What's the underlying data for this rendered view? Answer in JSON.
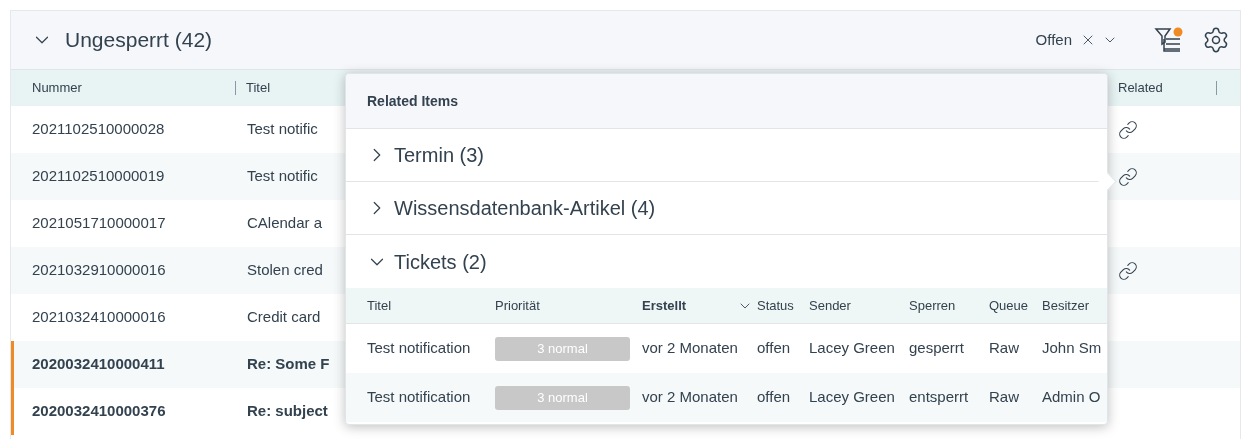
{
  "panel": {
    "title": "Ungesperrt (42)",
    "expanded": true,
    "filter": {
      "value": "Offen"
    }
  },
  "table": {
    "columns": [
      "Nummer",
      "Titel",
      "Related"
    ],
    "rows": [
      {
        "number": "2021102510000028",
        "title": "Test notific",
        "related": true,
        "unread": false
      },
      {
        "number": "2021102510000019",
        "title": "Test notific",
        "related": true,
        "unread": false
      },
      {
        "number": "2021051710000017",
        "title": "CAlendar a",
        "related": false,
        "unread": false
      },
      {
        "number": "2021032910000016",
        "title": "Stolen cred",
        "related": true,
        "unread": false
      },
      {
        "number": "2021032410000016",
        "title": "Credit card",
        "related": false,
        "unread": false
      },
      {
        "number": "2020032410000411",
        "title": "Re: Some F",
        "related": false,
        "unread": true
      },
      {
        "number": "2020032410000376",
        "title": "Re: subject",
        "related": false,
        "unread": true
      }
    ]
  },
  "popover": {
    "title": "Related Items",
    "sections": [
      {
        "label": "Termin (3)",
        "expanded": false
      },
      {
        "label": "Wissensdatenbank-Artikel (4)",
        "expanded": false
      },
      {
        "label": "Tickets (2)",
        "expanded": true
      }
    ],
    "tickets": {
      "columns": [
        {
          "label": "Titel",
          "sorted": false
        },
        {
          "label": "Priorität",
          "sorted": false
        },
        {
          "label": "Erstellt",
          "sorted": true
        },
        {
          "label": "Status",
          "sorted": false
        },
        {
          "label": "Sender",
          "sorted": false
        },
        {
          "label": "Sperren",
          "sorted": false
        },
        {
          "label": "Queue",
          "sorted": false
        },
        {
          "label": "Besitzer",
          "sorted": false
        }
      ],
      "rows": [
        [
          "Test notification",
          "3 normal",
          "vor 2 Monaten",
          "offen",
          "Lacey Green",
          "gesperrt",
          "Raw",
          "John Sm"
        ],
        [
          "Test notification",
          "3 normal",
          "vor 2 Monaten",
          "offen",
          "Lacey Green",
          "entsperrt",
          "Raw",
          "Admin O"
        ]
      ]
    }
  }
}
